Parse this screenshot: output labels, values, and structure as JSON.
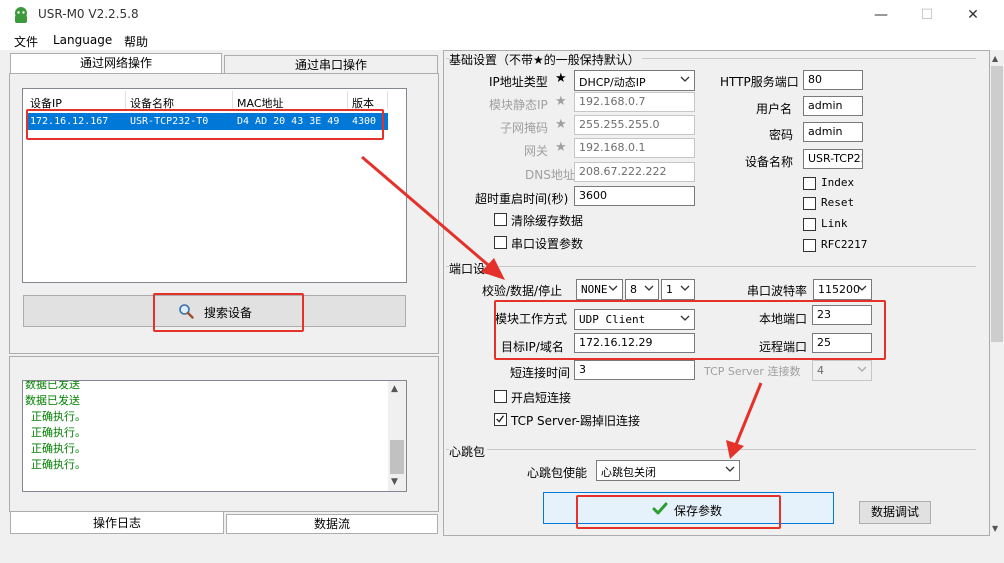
{
  "window": {
    "title": "USR-M0 V2.2.5.8",
    "minimize": "—",
    "maximize": "☐",
    "close": "✕"
  },
  "menu": [
    "文件",
    "Language",
    "帮助"
  ],
  "left": {
    "tabs": [
      "通过网络操作",
      "通过串口操作"
    ],
    "device_list": {
      "headers": [
        "设备IP",
        "设备名称",
        "MAC地址",
        "版本"
      ],
      "rows": [
        [
          "172.16.12.167",
          "USR-TCP232-T0",
          "D4 AD 20 43 3E 49",
          "4300"
        ]
      ]
    },
    "search_button": "搜索设备",
    "log_lines": [
      "数据已发送",
      "数据已发送",
      "正确执行。",
      "正确执行。",
      "正确执行。",
      "正确执行。"
    ],
    "bottom_tabs": [
      "操作日志",
      "数据流"
    ]
  },
  "basic": {
    "section_title": "基础设置（不带★的一般保持默认）",
    "ip_type_label": "IP地址类型",
    "ip_type_value": "DHCP/动态IP",
    "static_ip_label": "模块静态IP",
    "static_ip_value": "192.168.0.7",
    "subnet_label": "子网掩码",
    "subnet_value": "255.255.255.0",
    "gateway_label": "网关",
    "gateway_value": "192.168.0.1",
    "dns_label": "DNS地址",
    "dns_value": "208.67.222.222",
    "timeout_label": "超时重启时间(秒)",
    "timeout_value": "3600",
    "clear_cache_label": "清除缓存数据",
    "serial_params_label": "串口设置参数",
    "http_port_label": "HTTP服务端口",
    "http_port_value": "80",
    "username_label": "用户名",
    "username_value": "admin",
    "password_label": "密码",
    "password_value": "admin",
    "device_name_label": "设备名称",
    "device_name_value": "USR-TCP23",
    "options": [
      "Index",
      "Reset",
      "Link",
      "RFC2217"
    ],
    "star": "★"
  },
  "port": {
    "section_title": "端口设置",
    "parity_label": "校验/数据/停止",
    "parity_value": "NONE",
    "databits_value": "8",
    "stopbits_value": "1",
    "baud_label": "串口波特率",
    "baud_value": "115200",
    "mode_label": "模块工作方式",
    "mode_value": "UDP Client",
    "local_port_label": "本地端口",
    "local_port_value": "23",
    "target_label": "目标IP/域名",
    "target_value": "172.16.12.29",
    "remote_port_label": "远程端口",
    "remote_port_value": "25",
    "short_conn_label": "短连接时间",
    "short_conn_value": "3",
    "tcp_conn_label": "TCP Server 连接数",
    "tcp_conn_value": "4",
    "enable_short_label": "开启短连接",
    "kick_label": "TCP Server-踢掉旧连接"
  },
  "heartbeat": {
    "section_title": "心跳包",
    "enable_label": "心跳包使能",
    "enable_value": "心跳包关闭"
  },
  "actions": {
    "save": "保存参数",
    "debug": "数据调试"
  },
  "colors": {
    "highlight": "#0078d7",
    "annotation": "#e4322b",
    "log_text": "#008000",
    "check_green": "#2e9e2e"
  }
}
